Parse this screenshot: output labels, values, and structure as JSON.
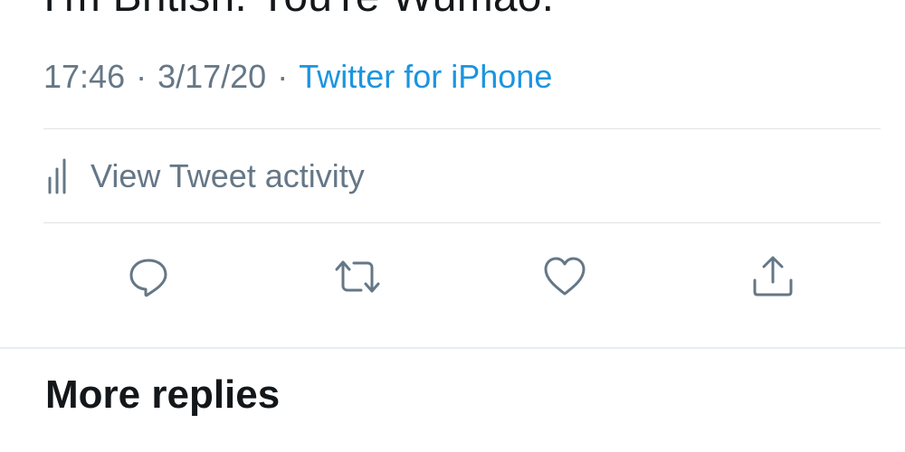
{
  "tweet": {
    "text": "I'm British. You're Wumao.",
    "time": "17:46",
    "separator": "·",
    "date": "3/17/20",
    "source": "Twitter for iPhone"
  },
  "activity": {
    "label": "View Tweet activity",
    "icon": "bar-chart-icon"
  },
  "actions": {
    "reply_icon": "comment-icon",
    "retweet_icon": "retweet-icon",
    "like_icon": "heart-icon",
    "share_icon": "share-icon"
  },
  "section": {
    "title": "More replies"
  },
  "colors": {
    "text": "#14171a",
    "secondary": "#657786",
    "link": "#1b95e0",
    "divider": "#dfe3e6"
  }
}
